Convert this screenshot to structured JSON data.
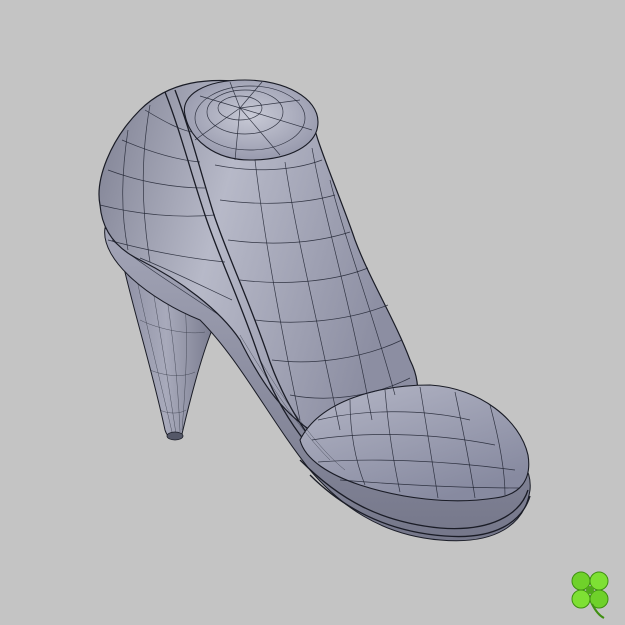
{
  "scene": {
    "background_color": "#c4c4c4",
    "model": "high-heel-bootie-wireframe",
    "surface_color": "#9a9cb0",
    "wire_color": "#1f2230"
  },
  "logo": {
    "icon": "four-leaf-clover-icon",
    "color": "#6fd12a"
  }
}
